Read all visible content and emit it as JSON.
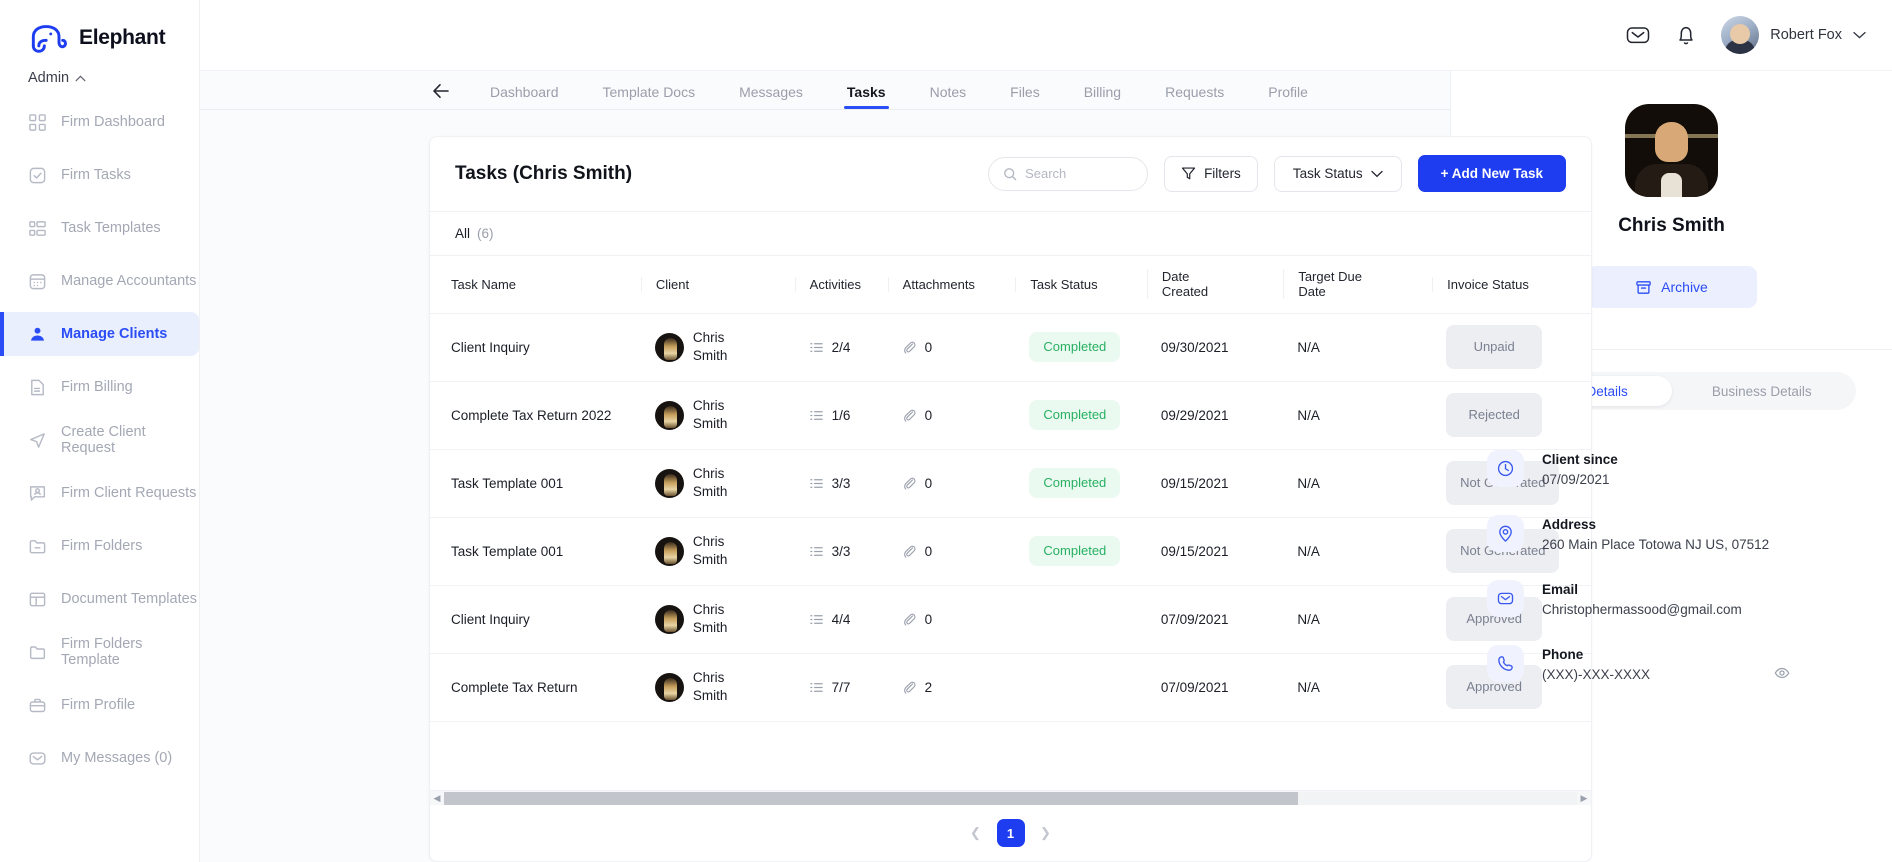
{
  "brand": {
    "name": "Elephant",
    "logo_icon": "elephant-logo-icon"
  },
  "sidebar": {
    "role_label": "Admin",
    "role_chevron_icon": "chevron-up-icon",
    "items": [
      {
        "label": "Firm Dashboard",
        "icon": "grid-icon",
        "active": false
      },
      {
        "label": "Firm Tasks",
        "icon": "check-square-icon",
        "active": false
      },
      {
        "label": "Task Templates",
        "icon": "layout-list-icon",
        "active": false
      },
      {
        "label": "Manage Accountants",
        "icon": "calendar-icon",
        "active": false
      },
      {
        "label": "Manage Clients",
        "icon": "users-icon",
        "active": true
      },
      {
        "label": "Firm Billing",
        "icon": "document-icon",
        "active": false
      },
      {
        "label": "Create Client Request",
        "icon": "send-icon",
        "active": false
      },
      {
        "label": "Firm Client Requests",
        "icon": "user-message-icon",
        "active": false
      },
      {
        "label": "Firm Folders",
        "icon": "folder-minus-icon",
        "active": false
      },
      {
        "label": "Document Templates",
        "icon": "template-icon",
        "active": false
      },
      {
        "label": "Firm Folders Template",
        "icon": "folder-icon",
        "active": false
      },
      {
        "label": "Firm Profile",
        "icon": "briefcase-icon",
        "active": false
      },
      {
        "label": "My Messages (0)",
        "icon": "envelope-icon",
        "active": false
      }
    ]
  },
  "topbar": {
    "mail_icon": "envelope-icon",
    "bell_icon": "bell-icon",
    "user_name": "Robert Fox",
    "user_chevron_icon": "chevron-down-icon",
    "avatar_icon": "user-avatar"
  },
  "tabs": {
    "back_icon": "arrow-left-icon",
    "items": [
      {
        "label": "Dashboard",
        "active": false
      },
      {
        "label": "Template Docs",
        "active": false
      },
      {
        "label": "Messages",
        "active": false
      },
      {
        "label": "Tasks",
        "active": true
      },
      {
        "label": "Notes",
        "active": false
      },
      {
        "label": "Files",
        "active": false
      },
      {
        "label": "Billing",
        "active": false
      },
      {
        "label": "Requests",
        "active": false
      },
      {
        "label": "Profile",
        "active": false
      }
    ]
  },
  "toolbar": {
    "title": "Tasks (Chris Smith)",
    "search_placeholder": "Search",
    "search_value": "",
    "search_icon": "search-icon",
    "filters_label": "Filters",
    "filters_icon": "funnel-icon",
    "task_status_label": "Task Status",
    "task_status_chevron_icon": "chevron-down-icon",
    "add_task_label": "+ Add New Task"
  },
  "filter_bar": {
    "all_label": "All",
    "count_label": "(6)"
  },
  "table": {
    "columns": [
      "Task Name",
      "Client",
      "Activities",
      "Attachments",
      "Task Status",
      "Date Created",
      "Target Due Date",
      "Invoice Status"
    ],
    "column_multiline": {
      "date_created": [
        "Date",
        "Created"
      ],
      "target_due_date": [
        "Target Due",
        "Date"
      ]
    },
    "activities_icon": "list-icon",
    "attachments_icon": "paperclip-icon",
    "rows": [
      {
        "task_name": "Client Inquiry",
        "client": "Chris Smith",
        "activities": "2/4",
        "attachments": "0",
        "task_status": "Completed",
        "date_created": "09/30/2021",
        "target_due_date": "N/A",
        "invoice_status": "Unpaid"
      },
      {
        "task_name": "Complete Tax Return 2022",
        "client": "Chris Smith",
        "activities": "1/6",
        "attachments": "0",
        "task_status": "Completed",
        "date_created": "09/29/2021",
        "target_due_date": "N/A",
        "invoice_status": "Rejected"
      },
      {
        "task_name": "Task Template 001",
        "client": "Chris Smith",
        "activities": "3/3",
        "attachments": "0",
        "task_status": "Completed",
        "date_created": "09/15/2021",
        "target_due_date": "N/A",
        "invoice_status": "Not Generated"
      },
      {
        "task_name": "Task Template 001",
        "client": "Chris Smith",
        "activities": "3/3",
        "attachments": "0",
        "task_status": "Completed",
        "date_created": "09/15/2021",
        "target_due_date": "N/A",
        "invoice_status": "Not Generated"
      },
      {
        "task_name": "Client Inquiry",
        "client": "Chris Smith",
        "activities": "4/4",
        "attachments": "0",
        "task_status": "",
        "date_created": "07/09/2021",
        "target_due_date": "N/A",
        "invoice_status": "Approved"
      },
      {
        "task_name": "Complete Tax Return",
        "client": "Chris Smith",
        "activities": "7/7",
        "attachments": "2",
        "task_status": "",
        "date_created": "07/09/2021",
        "target_due_date": "N/A",
        "invoice_status": "Approved"
      }
    ]
  },
  "pagination": {
    "prev_icon": "chevron-left-icon",
    "next_icon": "chevron-right-icon",
    "current_page": "1"
  },
  "right_panel": {
    "client_name": "Chris Smith",
    "avatar_icon": "client-avatar",
    "archive_label": "Archive",
    "archive_icon": "archive-icon",
    "segments": [
      {
        "label": "General Details",
        "active": true
      },
      {
        "label": "Business Details",
        "active": false
      }
    ],
    "details": [
      {
        "icon": "clock-icon",
        "label": "Client since",
        "value": "07/09/2021"
      },
      {
        "icon": "location-pin-icon",
        "label": "Address",
        "value": "260 Main Place Totowa NJ US, 07512"
      },
      {
        "icon": "envelope-icon",
        "label": "Email",
        "value": "Christophermassood@gmail.com"
      },
      {
        "icon": "phone-icon",
        "label": "Phone",
        "value": "(XXX)-XXX-XXXX",
        "reveal_icon": "eye-icon"
      }
    ]
  },
  "colors": {
    "accent_blue": "#1f3df0",
    "active_nav_bg": "#eaeffd",
    "status_completed_text": "#27b062",
    "status_completed_bg": "#eafaf0",
    "pill_grey_bg": "#eceef2",
    "pill_grey_text": "#7b8090"
  }
}
